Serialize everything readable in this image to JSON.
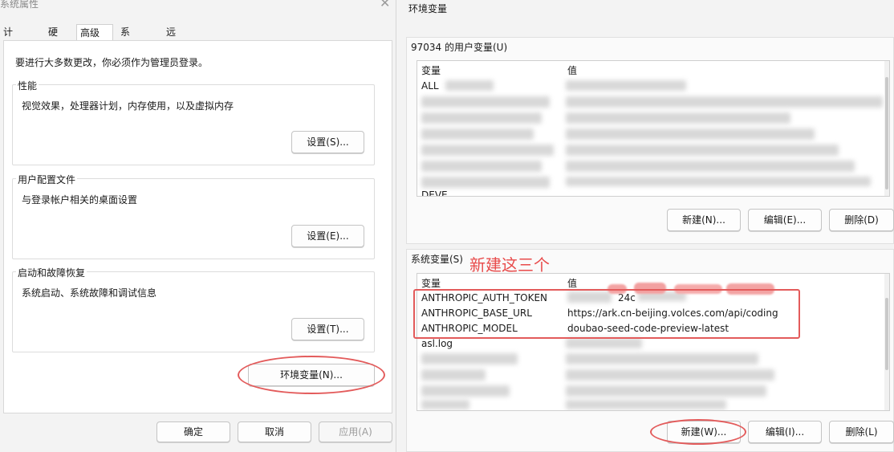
{
  "left_window": {
    "title": "系统属性",
    "tabs": [
      {
        "label": "计算机名"
      },
      {
        "label": "硬件"
      },
      {
        "label": "高级"
      },
      {
        "label": "系统保护"
      },
      {
        "label": "远程"
      }
    ],
    "admin_note": "要进行大多数更改，你必须作为管理员登录。",
    "groups": {
      "performance": {
        "title": "性能",
        "desc": "视觉效果，处理器计划，内存使用，以及虚拟内存",
        "button": "设置(S)..."
      },
      "profile": {
        "title": "用户配置文件",
        "desc": "与登录帐户相关的桌面设置",
        "button": "设置(E)..."
      },
      "startup": {
        "title": "启动和故障恢复",
        "desc": "系统启动、系统故障和调试信息",
        "button": "设置(T)..."
      }
    },
    "env_button": "环境变量(N)...",
    "footer": {
      "ok": "确定",
      "cancel": "取消",
      "apply": "应用(A)"
    }
  },
  "right_window": {
    "title": "环境变量",
    "user_vars": {
      "title": "97034 的用户变量(U)",
      "col_var": "变量",
      "col_val": "值",
      "visible_rows": [
        {
          "var": "ALL",
          "val": ""
        },
        {
          "var": "DEVE",
          "val": ""
        }
      ],
      "buttons": {
        "new": "新建(N)...",
        "edit": "编辑(E)...",
        "delete": "删除(D)"
      }
    },
    "system_vars": {
      "title": "系统变量(S)",
      "col_var": "变量",
      "col_val": "值",
      "rows": [
        {
          "var": "ANTHROPIC_AUTH_TOKEN",
          "val": "24c"
        },
        {
          "var": "ANTHROPIC_BASE_URL",
          "val": "https://ark.cn-beijing.volces.com/api/coding"
        },
        {
          "var": "ANTHROPIC_MODEL",
          "val": "doubao-seed-code-preview-latest"
        },
        {
          "var": "asl.log",
          "val": ""
        }
      ],
      "buttons": {
        "new": "新建(W)...",
        "edit": "编辑(I)...",
        "delete": "删除(L)"
      }
    }
  },
  "annotation": {
    "text": "新建这三个",
    "color": "#e84b4b"
  }
}
